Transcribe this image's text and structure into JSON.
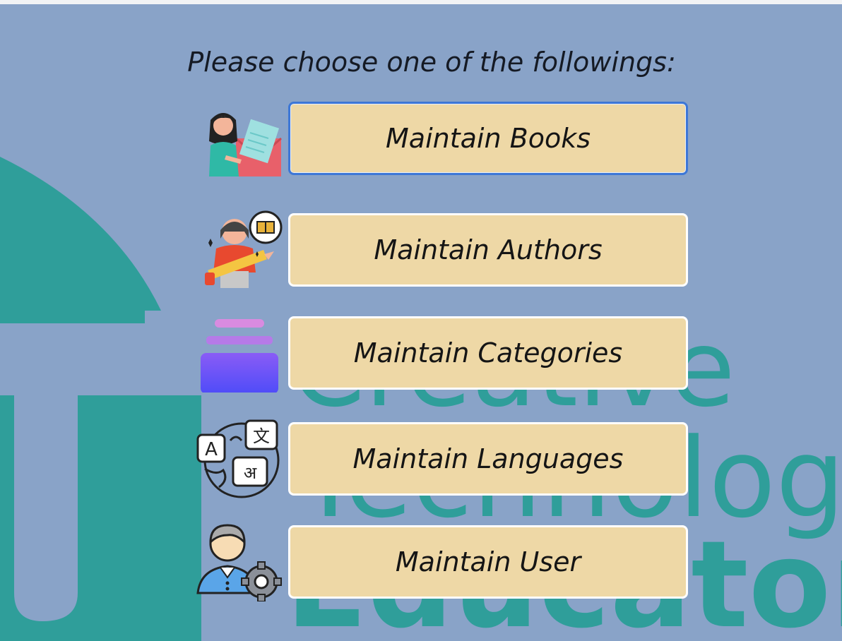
{
  "prompt": "Please choose one of the followings:",
  "watermark": {
    "line1": "Creative",
    "line2": "Technology",
    "line3": "Educators"
  },
  "menu": [
    {
      "label": "Maintain Books",
      "icon": "books-icon",
      "focused": true
    },
    {
      "label": "Maintain Authors",
      "icon": "author-icon",
      "focused": false
    },
    {
      "label": "Maintain Categories",
      "icon": "categories-icon",
      "focused": false
    },
    {
      "label": "Maintain Languages",
      "icon": "languages-icon",
      "focused": false
    },
    {
      "label": "Maintain User",
      "icon": "user-settings-icon",
      "focused": false
    }
  ],
  "colors": {
    "background": "#89a3c8",
    "button": "#eed8a6",
    "watermark": "#2f9e9a",
    "focus_border": "#3d77d6"
  }
}
